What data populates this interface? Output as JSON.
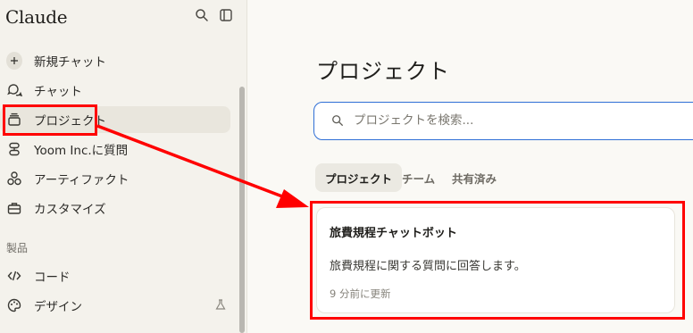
{
  "sidebar": {
    "brand": "Claude",
    "top_icons": [
      "search-icon",
      "sidebar-toggle-icon"
    ],
    "items": [
      {
        "label": "新規チャット",
        "icon": "plus-icon"
      },
      {
        "label": "チャット",
        "icon": "chat-bubbles-icon"
      },
      {
        "label": "プロジェクト",
        "icon": "stack-icon",
        "active": true
      },
      {
        "label": "Yoom Inc.に質問",
        "icon": "org-icon"
      },
      {
        "label": "アーティファクト",
        "icon": "shapes-icon"
      },
      {
        "label": "カスタマイズ",
        "icon": "briefcase-icon"
      }
    ],
    "section_label": "製品",
    "product_items": [
      {
        "label": "コード",
        "icon": "code-icon"
      },
      {
        "label": "デザイン",
        "icon": "palette-icon",
        "badge_icon": "flask-icon"
      }
    ]
  },
  "main": {
    "title": "プロジェクト",
    "search": {
      "placeholder": "プロジェクトを検索...",
      "value": ""
    },
    "tabs": [
      {
        "label": "プロジェクト",
        "active": true
      },
      {
        "label": "チーム",
        "active": false
      },
      {
        "label": "共有済み",
        "active": false
      }
    ],
    "project_card": {
      "title": "旅費規程チャットボット",
      "description": "旅費規程に関する質問に回答します。",
      "updated": "9 分前に更新"
    }
  },
  "annotation": {
    "highlight_color": "#ff0000"
  },
  "colors": {
    "sidebar_bg": "#f4f2ec",
    "main_bg": "#faf9f5",
    "active_item_bg": "#e9e6dd",
    "search_border": "#2f6fd6"
  }
}
